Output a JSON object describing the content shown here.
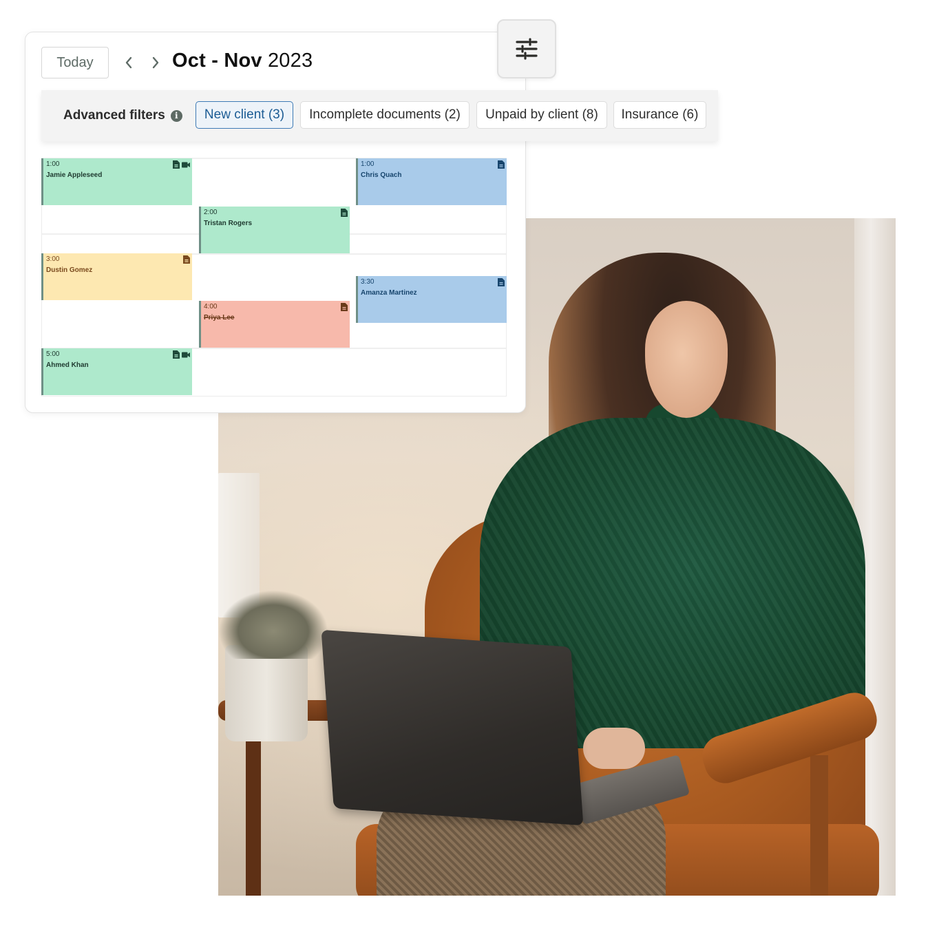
{
  "calendar": {
    "today_label": "Today",
    "prev_label": "previous",
    "next_label": "next",
    "date_range_months": "Oct - Nov",
    "date_range_year": "2023",
    "settings_icon": "sliders-icon"
  },
  "filters": {
    "label": "Advanced filters",
    "info_icon": "i",
    "chips": [
      {
        "label": "New client (3)",
        "active": true
      },
      {
        "label": "Incomplete documents (2)",
        "active": false
      },
      {
        "label": "Unpaid by client (8)",
        "active": false
      },
      {
        "label": "Insurance (6)",
        "active": false
      }
    ]
  },
  "events": [
    {
      "time": "1:00",
      "name": "Jamie Appleseed",
      "color": "green",
      "icons": [
        "document-icon",
        "video-icon"
      ]
    },
    {
      "time": "1:00",
      "name": "Chris Quach",
      "color": "blue",
      "icons": [
        "document-icon"
      ]
    },
    {
      "time": "2:00",
      "name": "Tristan Rogers",
      "color": "green",
      "icons": [
        "document-icon"
      ]
    },
    {
      "time": "3:00",
      "name": "Dustin Gomez",
      "color": "yellow",
      "icons": [
        "document-icon"
      ]
    },
    {
      "time": "3:30",
      "name": "Amanza Martinez",
      "color": "blue",
      "icons": [
        "document-icon"
      ]
    },
    {
      "time": "4:00",
      "name": "Priya Lee",
      "color": "red",
      "cancelled": true,
      "icons": [
        "document-icon"
      ]
    },
    {
      "time": "5:00",
      "name": "Ahmed Khan",
      "color": "green",
      "icons": [
        "document-icon",
        "video-icon"
      ]
    }
  ],
  "colors": {
    "green": "#aee9cc",
    "blue": "#a9cbea",
    "yellow": "#fde8b1",
    "red": "#f7b9ab",
    "active_chip_border": "#3d7ab5"
  },
  "photo": {
    "description": "Woman in green sweater using laptop in leather armchair"
  }
}
